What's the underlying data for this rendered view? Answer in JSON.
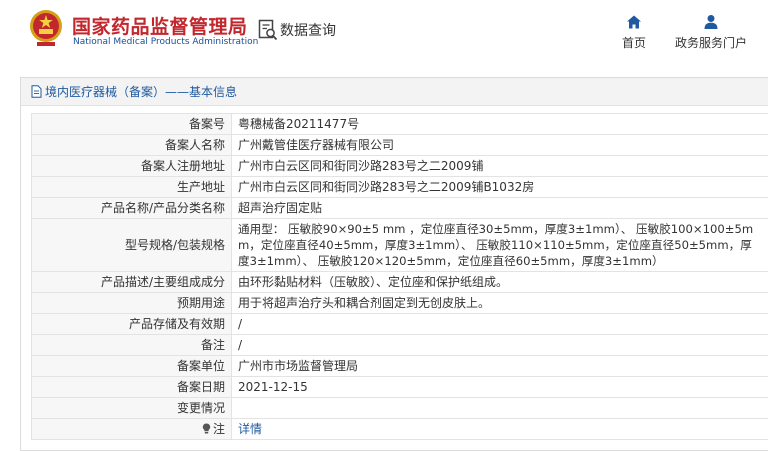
{
  "header": {
    "org_name_cn": "国家药品监督管理局",
    "org_name_en": "National Medical Products Administration",
    "search_label": "数据查询",
    "nav": {
      "home_label": "首页",
      "services_label": "政务服务门户"
    }
  },
  "breadcrumb": {
    "text": "境内医疗器械（备案）——基本信息"
  },
  "detail_rows": [
    {
      "label": "备案号",
      "value": "粤穗械备20211477号"
    },
    {
      "label": "备案人名称",
      "value": "广州戴管佳医疗器械有限公司"
    },
    {
      "label": "备案人注册地址",
      "value": "广州市白云区同和街同沙路283号之二2009铺"
    },
    {
      "label": "生产地址",
      "value": "广州市白云区同和街同沙路283号之二2009铺B1032房"
    },
    {
      "label": "产品名称/产品分类名称",
      "value": "超声治疗固定贴"
    },
    {
      "label": "型号规格/包装规格",
      "value": "通用型： 压敏胶90×90±5 mm ，定位座直径30±5mm，厚度3±1mm）、 压敏胶100×100±5mm，定位座直径40±5mm，厚度3±1mm）、 压敏胶110×110±5mm，定位座直径50±5mm，厚度3±1mm）、 压敏胶120×120±5mm，定位座直径60±5mm，厚度3±1mm）"
    },
    {
      "label": "产品描述/主要组成成分",
      "value": "由环形黏贴材料（压敏胶）、定位座和保护纸组成。"
    },
    {
      "label": "预期用途",
      "value": "用于将超声治疗头和耦合剂固定到无创皮肤上。"
    },
    {
      "label": "产品存储及有效期",
      "value": "/"
    },
    {
      "label": "备注",
      "value": "/"
    },
    {
      "label": "备案单位",
      "value": "广州市市场监督管理局"
    },
    {
      "label": "备案日期",
      "value": "2021-12-15"
    },
    {
      "label": "变更情况",
      "value": ""
    },
    {
      "label": "注",
      "value": "详情"
    }
  ],
  "colors": {
    "brand_red": "#c1272d",
    "brand_blue": "#1f5aa0",
    "label_bg": "#f7f7f7",
    "border": "#e3e3e3"
  },
  "icons": [
    "national-emblem-icon",
    "data-search-icon",
    "home-icon",
    "user-icon",
    "document-icon",
    "lightbulb-icon"
  ]
}
